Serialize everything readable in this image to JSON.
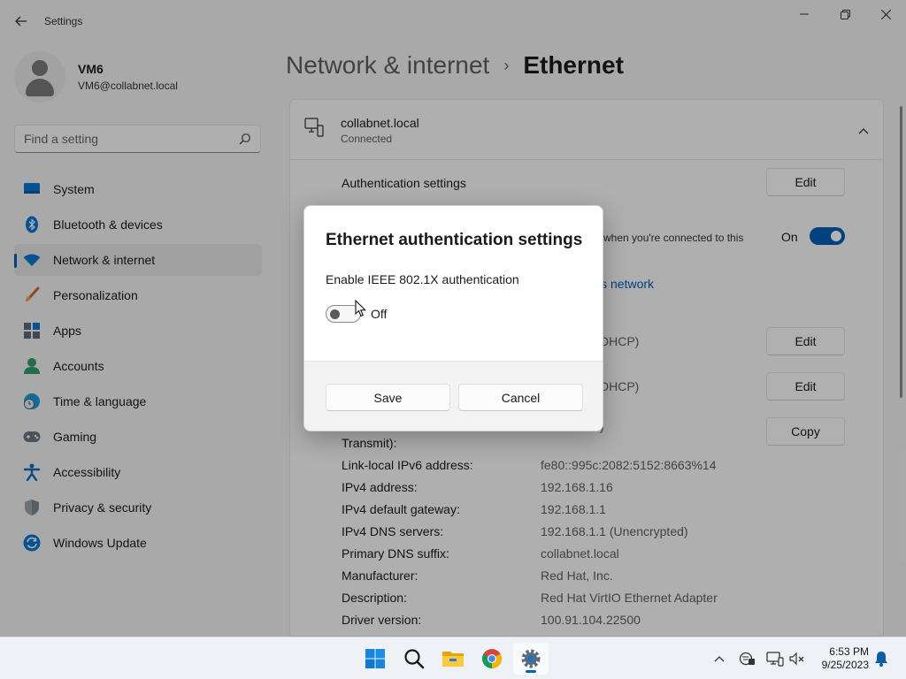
{
  "window": {
    "title": "Settings"
  },
  "profile": {
    "name": "VM6",
    "email": "VM6@collabnet.local"
  },
  "search": {
    "placeholder": "Find a setting"
  },
  "nav": {
    "items": [
      {
        "label": "System",
        "icon": "system-icon"
      },
      {
        "label": "Bluetooth & devices",
        "icon": "bluetooth-icon"
      },
      {
        "label": "Network & internet",
        "icon": "wifi-icon",
        "active": true
      },
      {
        "label": "Personalization",
        "icon": "brush-icon"
      },
      {
        "label": "Apps",
        "icon": "apps-icon"
      },
      {
        "label": "Accounts",
        "icon": "accounts-icon"
      },
      {
        "label": "Time & language",
        "icon": "clock-globe-icon"
      },
      {
        "label": "Gaming",
        "icon": "gamepad-icon"
      },
      {
        "label": "Accessibility",
        "icon": "accessibility-icon"
      },
      {
        "label": "Privacy & security",
        "icon": "shield-icon"
      },
      {
        "label": "Windows Update",
        "icon": "update-icon"
      }
    ]
  },
  "breadcrumb": {
    "parent": "Network & internet",
    "separator": "›",
    "current": "Ethernet"
  },
  "network": {
    "name": "collabnet.local",
    "status": "Connected",
    "auth_label": "Authentication settings",
    "edit_label": "Edit",
    "metered_text_partial": "e when you're connected to this",
    "metered_state": "On",
    "data_limit_link_partial": "is network",
    "ip_assignment_partial": "DHCP)",
    "dns_assignment_partial": "DHCP)",
    "copy_label": "Copy",
    "link_speed_label_tail": "Transmit):",
    "link_speed_value_tail": ")",
    "properties": [
      {
        "label": "Link-local IPv6 address:",
        "value": "fe80::995c:2082:5152:8663%14"
      },
      {
        "label": "IPv4 address:",
        "value": "192.168.1.16"
      },
      {
        "label": "IPv4 default gateway:",
        "value": "192.168.1.1"
      },
      {
        "label": "IPv4 DNS servers:",
        "value": "192.168.1.1 (Unencrypted)"
      },
      {
        "label": "Primary DNS suffix:",
        "value": "collabnet.local"
      },
      {
        "label": "Manufacturer:",
        "value": "Red Hat, Inc."
      },
      {
        "label": "Description:",
        "value": "Red Hat VirtIO Ethernet Adapter"
      },
      {
        "label": "Driver version:",
        "value": "100.91.104.22500"
      }
    ]
  },
  "dialog": {
    "title": "Ethernet authentication settings",
    "option_label": "Enable IEEE 802.1X authentication",
    "toggle_state": "Off",
    "toggle_value": false,
    "save_label": "Save",
    "cancel_label": "Cancel"
  },
  "taskbar": {
    "apps": [
      "start-icon",
      "search-icon",
      "file-explorer-icon",
      "chrome-icon",
      "settings-icon"
    ],
    "time": "6:53 PM",
    "date": "9/25/2023"
  },
  "colors": {
    "accent": "#005fb8",
    "background": "#f3f3f3",
    "card": "#fbfbfb"
  }
}
